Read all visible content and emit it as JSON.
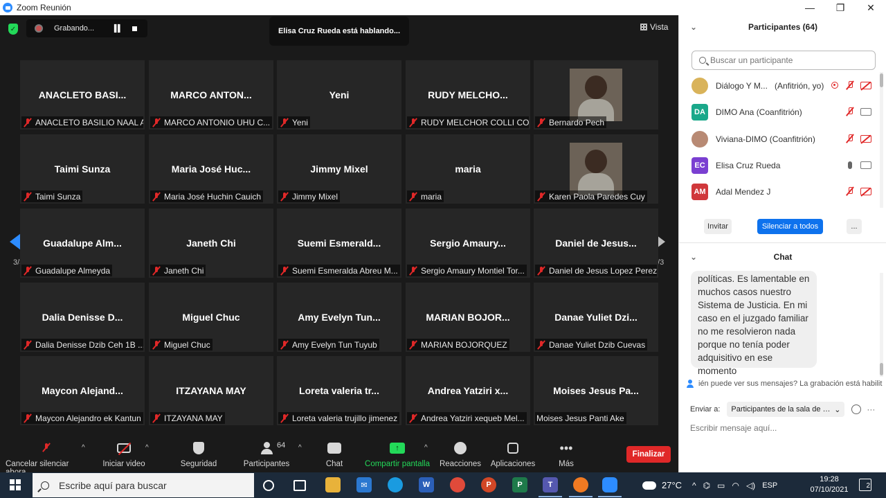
{
  "window": {
    "title": "Zoom Reunión",
    "minimize": "—",
    "maximize": "❐",
    "close": "✕"
  },
  "meeting": {
    "recording_label": "Grabando...",
    "speaking_banner": "Elisa Cruz Rueda está hablando...",
    "view_label": "Vista",
    "page_left": "3/3",
    "page_right": "3/3",
    "tiles": [
      {
        "big": "ANACLETO  BASI...",
        "name": "ANACLETO BASILIO NAAL AC"
      },
      {
        "big": "MARCO  ANTON...",
        "name": "MARCO ANTONIO UHU C..."
      },
      {
        "big": "Yeni",
        "name": "Yeni"
      },
      {
        "big": "RUDY  MELCHO...",
        "name": "RUDY MELCHOR COLLI CO..."
      },
      {
        "big": "",
        "name": "Bernardo Pech",
        "photo": true
      },
      {
        "big": "Taimi Sunza",
        "name": "Taimi Sunza"
      },
      {
        "big": "Maria José  Huc...",
        "name": "Maria José Huchin Cauich"
      },
      {
        "big": "Jimmy Mixel",
        "name": "Jimmy Mixel"
      },
      {
        "big": "maria",
        "name": "maria"
      },
      {
        "big": "",
        "name": "Karen Paola Paredes Cuy",
        "photo": true
      },
      {
        "big": "Guadalupe  Alm...",
        "name": "Guadalupe Almeyda"
      },
      {
        "big": "Janeth Chi",
        "name": "Janeth Chi"
      },
      {
        "big": "Suemi  Esmerald...",
        "name": "Suemi Esmeralda Abreu M..."
      },
      {
        "big": "Sergio  Amaury...",
        "name": "Sergio Amaury Montiel Tor..."
      },
      {
        "big": "Daniel  de  Jesus...",
        "name": "Daniel de Jesus Lopez Perez"
      },
      {
        "big": "Dalia  Denisse  D...",
        "name": "Dalia Denisse Dzib Ceh 1B ..."
      },
      {
        "big": "Miguel Chuc",
        "name": "Miguel Chuc"
      },
      {
        "big": "Amy  Evelyn  Tun...",
        "name": "Amy Evelyn Tun Tuyub"
      },
      {
        "big": "MARIAN  BOJOR...",
        "name": "MARIAN BOJORQUEZ"
      },
      {
        "big": "Danae  Yuliet  Dzi...",
        "name": "Danae Yuliet Dzib Cuevas"
      },
      {
        "big": "Maycon  Alejand...",
        "name": "Maycon Alejandro ek Kantun"
      },
      {
        "big": "ITZAYANA MAY",
        "name": "ITZAYANA MAY"
      },
      {
        "big": "Loreta  valeria  tr...",
        "name": "Loreta valeria trujillo jimenez"
      },
      {
        "big": "Andrea  Yatziri  x...",
        "name": "Andrea Yatziri xequeb Mel..."
      },
      {
        "big": "Moises  Jesus  Pa...",
        "name": "Moises Jesus Panti Ake",
        "nomic": true
      }
    ]
  },
  "toolbar": {
    "mute": "Cancelar silenciar ahora",
    "video": "Iniciar video",
    "security": "Seguridad",
    "participants": "Participantes",
    "participants_count": "64",
    "chat": "Chat",
    "share": "Compartir pantalla",
    "reactions": "Reacciones",
    "apps": "Aplicaciones",
    "more": "Más",
    "end": "Finalizar"
  },
  "participants_panel": {
    "title": "Participantes (64)",
    "search_placeholder": "Buscar un participante",
    "list": [
      {
        "name": "Diálogo Y M...",
        "role": "(Anfitrión, yo)",
        "initials": "",
        "color": "#d9b35a"
      },
      {
        "name": "DIMO Ana (Coanfitrión)",
        "role": "",
        "initials": "DA",
        "color": "#1aa88a"
      },
      {
        "name": "Viviana-DIMO (Coanfitrión)",
        "role": "",
        "initials": "",
        "color": "#b88a74"
      },
      {
        "name": "Elisa Cruz Rueda",
        "role": "",
        "initials": "EC",
        "color": "#7a3fd1"
      },
      {
        "name": "Adal Mendez J",
        "role": "",
        "initials": "AM",
        "color": "#d0383b"
      }
    ],
    "invite": "Invitar",
    "mute_all": "Silenciar a todos",
    "more": "..."
  },
  "chat_panel": {
    "title": "Chat",
    "message": "políticas. Es lamentable en muchos casos nuestro Sistema de Justicia. En mi caso en el juzgado familiar no me resolvieron nada porque no tenía poder adquisitivo en ese momento",
    "notice": "ién puede ver sus mensajes? La grabación está habilit",
    "send_to_label": "Enviar a:",
    "send_to_value": "Participantes de la sala de es...",
    "input_placeholder": "Escribir mensaje aquí..."
  },
  "taskbar": {
    "search_placeholder": "Escribe aquí para buscar",
    "temperature": "27°C",
    "language": "ESP",
    "time": "19:28",
    "date": "07/10/2021",
    "notifications": "2"
  }
}
